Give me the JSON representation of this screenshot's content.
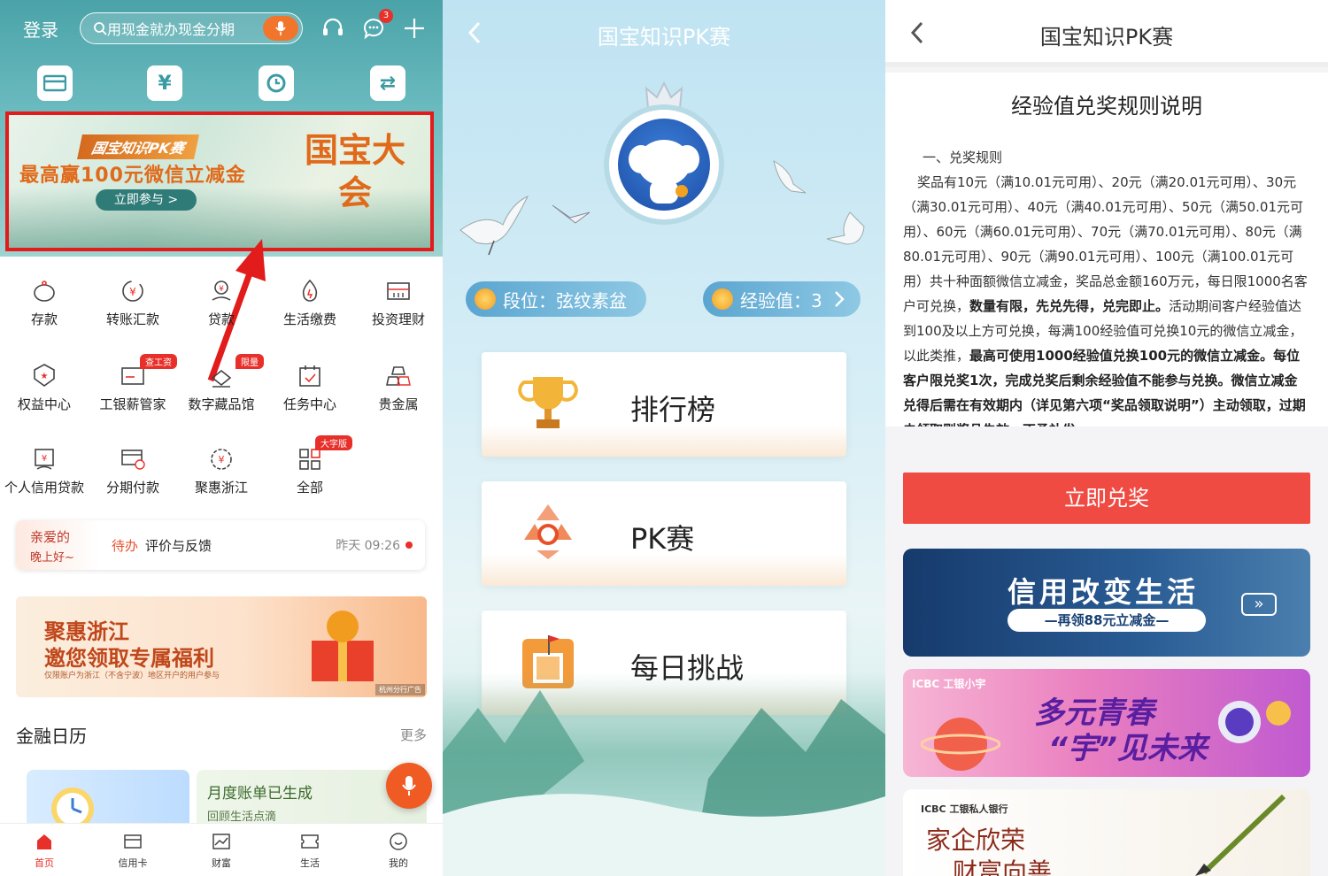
{
  "panel1": {
    "login": "登录",
    "search_text": "用现金就办现金分期",
    "message_badge": "3",
    "quick": [
      {
        "label": "账户",
        "icon": "card-icon"
      },
      {
        "label": "资产",
        "icon": "yen-icon"
      },
      {
        "label": "明细",
        "icon": "clock-icon"
      },
      {
        "label": "转账",
        "icon": "transfer-icon"
      }
    ],
    "banner": {
      "tag": "国宝知识PK赛",
      "headline": "最高赢100元微信立减金",
      "button": "立即参与 >",
      "seal": "国宝大会"
    },
    "grid": [
      {
        "label": "存款"
      },
      {
        "label": "转账汇款"
      },
      {
        "label": "贷款"
      },
      {
        "label": "生活缴费"
      },
      {
        "label": "投资理财"
      },
      {
        "label": "权益中心"
      },
      {
        "label": "工银薪管家",
        "tag": "查工资"
      },
      {
        "label": "数字藏品馆",
        "tag": "限量"
      },
      {
        "label": "任务中心"
      },
      {
        "label": "贵金属"
      },
      {
        "label": "个人信用贷款"
      },
      {
        "label": "分期付款"
      },
      {
        "label": "聚惠浙江"
      },
      {
        "label": "全部",
        "tag": "大字版"
      }
    ],
    "todo": {
      "dear": "亲爱的",
      "greet": "晚上好~",
      "type": "待办",
      "text": "评价与反馈",
      "time": "昨天 09:26"
    },
    "promo": {
      "line1": "聚惠浙江",
      "line2": "邀您领取专属福利",
      "note": "仅限账户为浙江（不含宁波）地区开户的用户参与",
      "corner": "杭州分行广告"
    },
    "fin_title": "金融日历",
    "more": "更多",
    "card2_title": "月度账单已生成",
    "card2_sub": "回顾生活点滴",
    "tabs": [
      {
        "label": "首页"
      },
      {
        "label": "信用卡"
      },
      {
        "label": "财富"
      },
      {
        "label": "生活"
      },
      {
        "label": "我的"
      }
    ]
  },
  "panel2": {
    "title": "国宝知识PK赛",
    "rank_label": "段位：弦纹素盆",
    "exp_label": "经验值：3",
    "menu": [
      {
        "label": "排行榜",
        "icon": "trophy-icon"
      },
      {
        "label": "PK赛",
        "icon": "pk-icon"
      },
      {
        "label": "每日挑战",
        "icon": "flag-icon"
      }
    ]
  },
  "panel3": {
    "title": "国宝知识PK赛",
    "rules_title": "经验值兑奖规则说明",
    "section": "一、兑奖规则",
    "para1": "奖品有10元（满10.01元可用）、20元（满20.01元可用）、30元（满30.01元可用）、40元（满40.01元可用）、50元（满50.01元可用）、60元（满60.01元可用）、70元（满70.01元可用）、80元（满80.01元可用）、90元（满90.01元可用）、100元（满100.01元可用）共十种面额微信立减金，奖品总金额160万元，每日限1000名客户可兑换，",
    "para1_bold": "数量有限，先兑先得，兑完即止。",
    "para2": "活动期间客户经验值达到100及以上方可兑换，每满100经验值可兑换10元的微信立减金，以此类推，",
    "para2_bold": "最高可使用1000经验值兑换100元的微信立减金。每位客户限兑奖1次，完成兑奖后剩余经验值不能参与兑换。微信立减金兑得后需在有效期内（详见第六项“奖品领取说明”）主动领取，过期未领取则奖品失效，不予补发",
    "redeem_button": "立即兑奖",
    "ad1_title": "信用改变生活",
    "ad1_sub": "—再领88元立减金—",
    "ad2_logo": "ICBC 工银小宇",
    "ad2_line1": "多元青春",
    "ad2_line2": "“宇”见未来",
    "ad3_logo": "ICBC 工银私人银行",
    "ad3_line1": "家企欣荣",
    "ad3_line2": "财富向善"
  }
}
